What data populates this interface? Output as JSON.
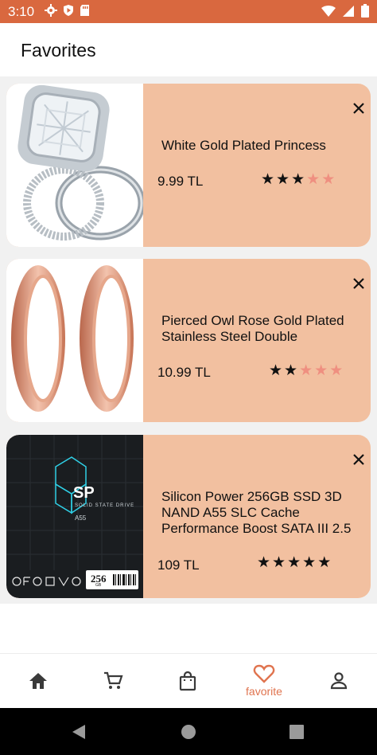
{
  "status_bar": {
    "time": "3:10",
    "color": "#d9683f"
  },
  "title": "Favorites",
  "accent": "#e0744f",
  "card_bg": "#f2c0a0",
  "favorites": [
    {
      "title": "White Gold Plated Princess",
      "price": "9.99 TL",
      "rating": 3,
      "max_rating": 5,
      "image": "diamond-ring-image"
    },
    {
      "title": "Pierced Owl Rose Gold Plated Stainless Steel Double",
      "price": "10.99 TL",
      "rating": 2,
      "max_rating": 5,
      "image": "rose-gold-tunnels-image"
    },
    {
      "title": "Silicon Power 256GB SSD 3D NAND A55 SLC Cache Performance Boost SATA III 2.5",
      "price": "109 TL",
      "rating": 5,
      "max_rating": 5,
      "image": "ssd-image"
    }
  ],
  "ssd_image": {
    "brand": "SP",
    "line": "Solid State Drive",
    "model": "A55",
    "capacity": "256",
    "unit": "GB"
  },
  "bottom_nav": [
    {
      "icon": "home-icon",
      "label": ""
    },
    {
      "icon": "cart-icon",
      "label": ""
    },
    {
      "icon": "bag-icon",
      "label": ""
    },
    {
      "icon": "heart-icon",
      "label": "favorite",
      "active": true
    },
    {
      "icon": "person-icon",
      "label": ""
    }
  ]
}
